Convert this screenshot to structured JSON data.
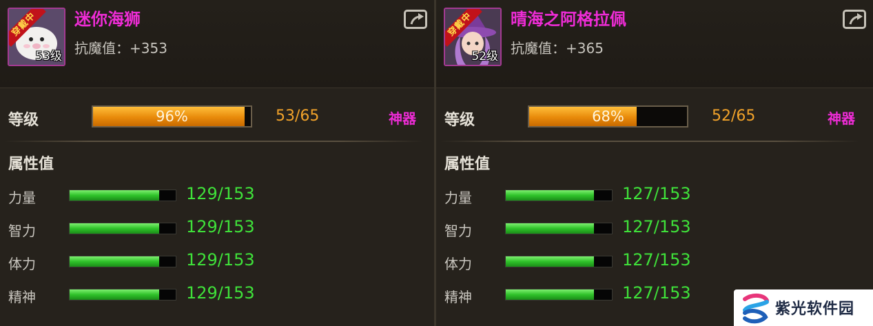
{
  "panels": [
    {
      "name": "迷你海狮",
      "level_badge": "53级",
      "worn_label": "穿戴中",
      "stat": "抗魔值：+353",
      "level_label": "等级",
      "exp_percent_text": "96%",
      "exp_fraction": 0.96,
      "level_value": "53/65",
      "artifact_label": "神器",
      "attr_title": "属性值",
      "attributes": [
        {
          "label": "力量",
          "value": "129/153",
          "ratio": 0.843
        },
        {
          "label": "智力",
          "value": "129/153",
          "ratio": 0.843
        },
        {
          "label": "体力",
          "value": "129/153",
          "ratio": 0.843
        },
        {
          "label": "精神",
          "value": "129/153",
          "ratio": 0.843
        }
      ],
      "avatar_icon": "seal-pet-icon"
    },
    {
      "name": "晴海之阿格拉佩",
      "level_badge": "52级",
      "worn_label": "穿戴中",
      "stat": "抗魔值：+365",
      "level_label": "等级",
      "exp_percent_text": "68%",
      "exp_fraction": 0.68,
      "level_value": "52/65",
      "artifact_label": "神器",
      "attr_title": "属性值",
      "attributes": [
        {
          "label": "力量",
          "value": "127/153",
          "ratio": 0.83
        },
        {
          "label": "智力",
          "value": "127/153",
          "ratio": 0.83
        },
        {
          "label": "体力",
          "value": "127/153",
          "ratio": 0.83
        },
        {
          "label": "精神",
          "value": "127/153",
          "ratio": 0.83
        }
      ],
      "avatar_icon": "witch-pet-icon"
    }
  ],
  "watermark": {
    "text": "紫光软件园"
  },
  "colors": {
    "name": "#ee2cd6",
    "exp_bar": "#e88a0a",
    "level_value": "#f2a32a",
    "attr_bar": "#2fc22a",
    "attr_value": "#3fe23a"
  }
}
